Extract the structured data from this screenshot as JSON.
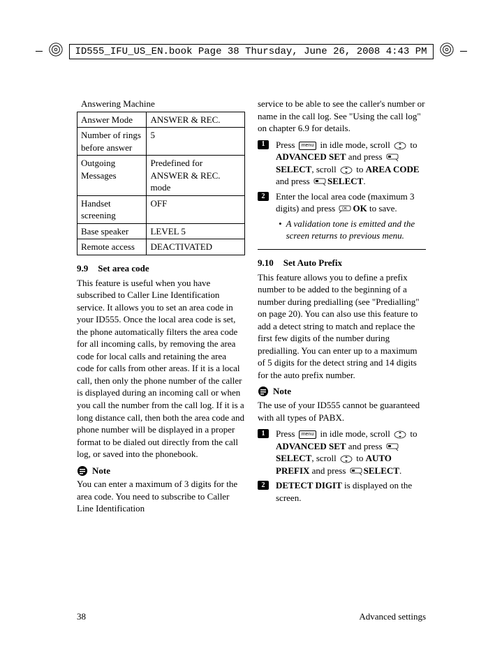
{
  "banner": {
    "text": "ID555_IFU_US_EN.book  Page 38  Thursday, June 26, 2008  4:43 PM"
  },
  "table": {
    "title": "Answering Machine",
    "rows": [
      {
        "k": "Answer Mode",
        "v": "ANSWER & REC."
      },
      {
        "k": "Number of rings before answer",
        "v": "5"
      },
      {
        "k": "Outgoing Messages",
        "v": "Predefined for ANSWER & REC. mode"
      },
      {
        "k": "Handset screening",
        "v": "OFF"
      },
      {
        "k": "Base speaker",
        "v": "LEVEL 5"
      },
      {
        "k": "Remote access",
        "v": "DEACTIVATED"
      }
    ]
  },
  "s99": {
    "num": "9.9",
    "title": "Set area code",
    "body": "This feature is useful when you have subscribed to Caller Line Identification service. It allows you to set an area code in your ID555. Once the local area code is set, the phone automatically filters the area code for all incoming calls, by removing the area code for local calls and retaining the area code for calls from other areas. If it is a local call, then only the phone number of the caller is displayed during an incoming call or when you call the number from the call log. If it is a long distance call, then both the area code and phone number will be displayed in a proper format to be dialed out directly from the call log, or saved into the phonebook.",
    "note_label": "Note",
    "note1": "You can enter a maximum of 3 digits for the area code. You need to subscribe to Caller Line Identification",
    "note1_cont": "service to be able to see the caller's number or name in the call log. See \"Using the call log\" on chapter 6.9 for details.",
    "step1": {
      "a": "Press ",
      "b": " in idle mode, scroll ",
      "c": " to ",
      "d": "ADVANCED SET",
      "e": "  and press ",
      "f": "SELECT",
      "g": ", scroll ",
      "h": " to ",
      "i": "AREA CODE",
      "j": " and press ",
      "k": "SELECT",
      "l": "."
    },
    "step2": {
      "a": "Enter the local area code (maximum 3 digits) and press ",
      "b": "OK",
      "c": " to save.",
      "sub": "A validation tone is emitted and the screen returns to previous menu."
    }
  },
  "s910": {
    "num": "9.10",
    "title": "Set Auto Prefix",
    "body": "This feature allows you to define a prefix number to be added to the beginning of a number during predialling (see \"Predialling\" on page 20). You can also use this feature to add a detect string to match and replace the first few digits of the number during predialling. You can enter up to a maximum of 5 digits for the detect string and 14 digits for the auto prefix number.",
    "note_label": "Note",
    "note": "The use of your ID555 cannot be guaranteed with all types of PABX.",
    "step1": {
      "a": "Press ",
      "b": " in idle mode, scroll ",
      "c": " to ",
      "d": "ADVANCED SET",
      "e": " and press ",
      "f": "SELECT",
      "g": ", scroll ",
      "h": " to ",
      "i": "AUTO PREFIX",
      "j": " and press ",
      "k": "SELECT",
      "l": "."
    },
    "step2": {
      "a": "DETECT DIGIT",
      "b": " is displayed on the screen."
    }
  },
  "footer": {
    "page": "38",
    "section": "Advanced settings"
  }
}
